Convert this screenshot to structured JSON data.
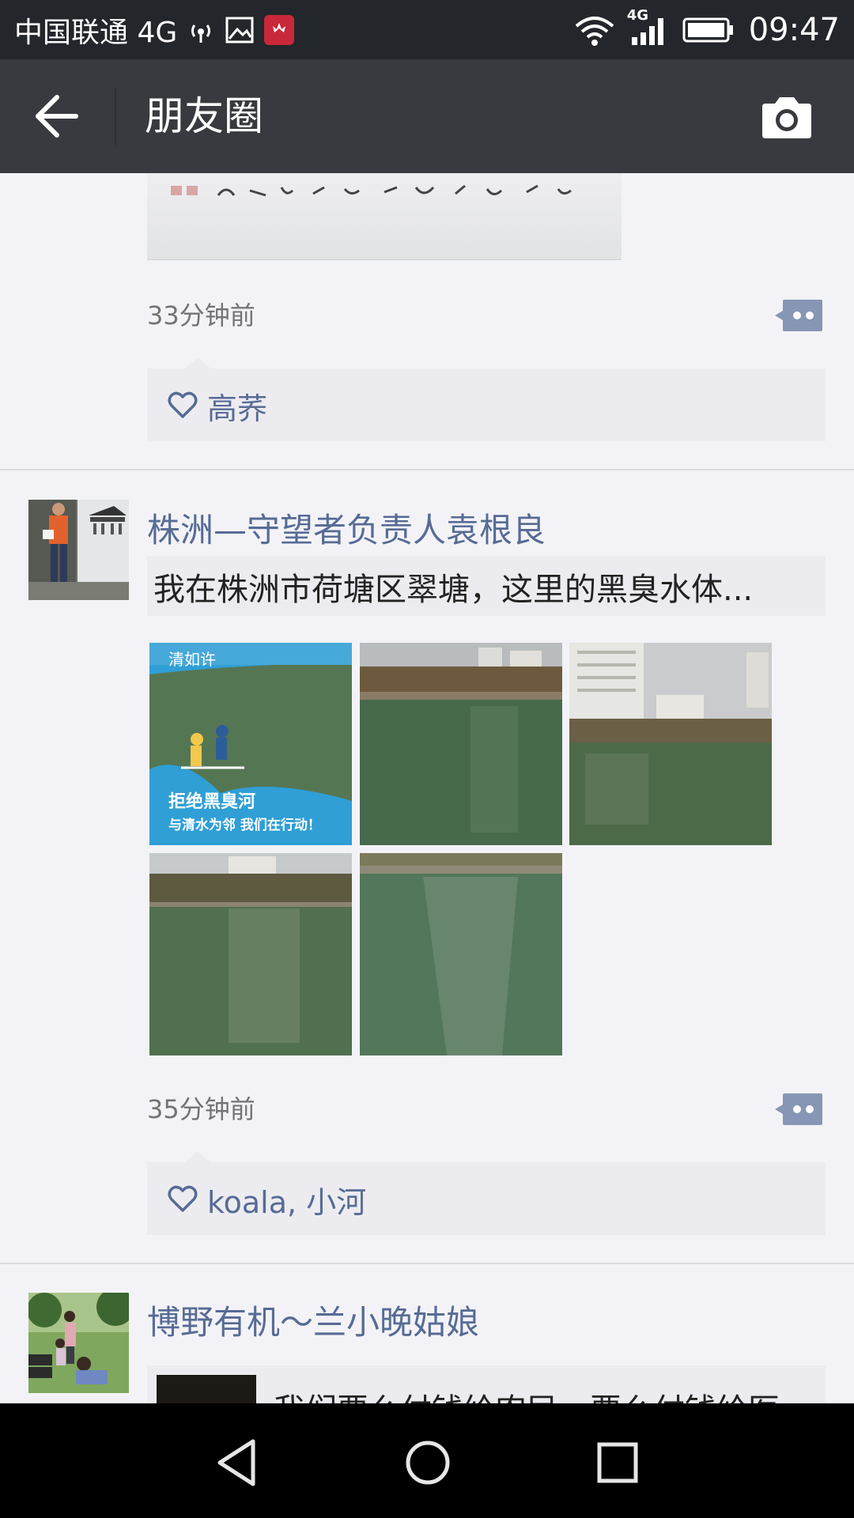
{
  "status_bar": {
    "carrier": "中国联通 4G",
    "network_label": "4G",
    "time": "09:47"
  },
  "title_bar": {
    "title": "朋友圈"
  },
  "posts": [
    {
      "time": "33分钟前",
      "likes": "高荞"
    },
    {
      "author": "株洲—守望者负责人袁根良",
      "shared_text": "我在株洲市荷塘区翠塘，这里的黑臭水体...",
      "photo1_text_top": "清如许",
      "photo1_text_mid": "拒绝黑臭河",
      "photo1_text_bottom": "与清水为邻  我们在行动！",
      "time": "35分钟前",
      "likes": "koala, 小河"
    },
    {
      "author": "博野有机～兰小晚姑娘",
      "shared_text": "我们要么付钱给农民，要么付钱给医"
    }
  ],
  "colors": {
    "link_blue": "#576b95",
    "titlebar": "#393a3f",
    "statusbar": "#23262b"
  }
}
